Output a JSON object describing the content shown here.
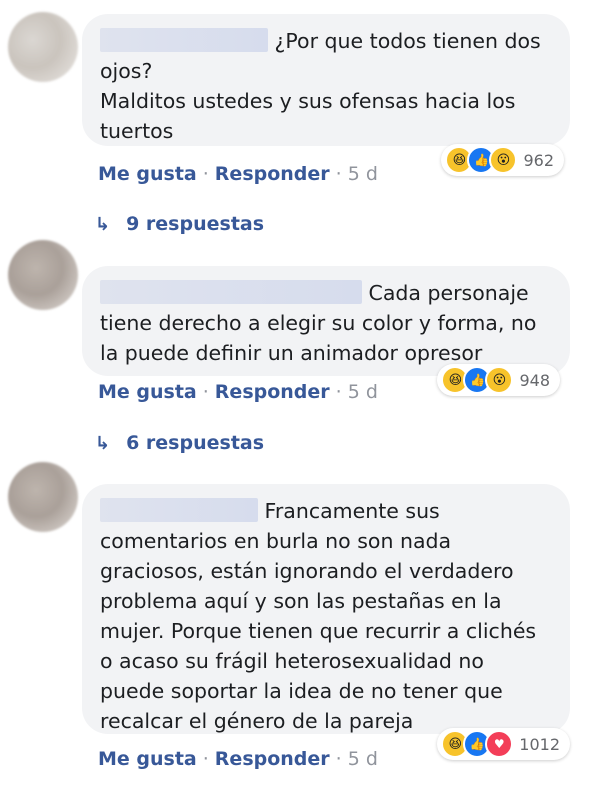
{
  "comments": [
    {
      "text": "¿Por que todos tienen dos ojos?\nMalditos ustedes y sus ofensas hacia los tuertos",
      "text_line1": "¿Por que todos tienen dos",
      "text_rest": "ojos? Malditos ustedes y sus ofensas hacia los tuertos",
      "reactions": [
        "haha",
        "like",
        "wow"
      ],
      "reaction_count": "962",
      "like_label": "Me gusta",
      "reply_label": "Responder",
      "time": "5 d",
      "replies_label": "9 respuestas"
    },
    {
      "text_line1": "Cada personaje",
      "text_rest": "tiene derecho a elegir su color y forma, no la puede definir un animador opresor",
      "reactions": [
        "haha",
        "like",
        "wow"
      ],
      "reaction_count": "948",
      "like_label": "Me gusta",
      "reply_label": "Responder",
      "time": "5 d",
      "replies_label": "6 respuestas"
    },
    {
      "text_line1": "Francamente sus",
      "text_rest": "comentarios en burla no son nada graciosos, están ignorando el verdadero problema aquí y son las pestañas en la mujer. Porque tienen que recurrir a clichés o acaso su frágil heterosexualidad no puede soportar la idea de no tener que recalcar el género de la pareja",
      "reactions": [
        "haha",
        "like",
        "love"
      ],
      "reaction_count": "1012",
      "like_label": "Me gusta",
      "reply_label": "Responder",
      "time": "5 d"
    }
  ],
  "separator": "·",
  "icons": {
    "haha": "😆",
    "like": "👍",
    "wow": "😮",
    "love": "♥",
    "reply_arrow": "↳"
  },
  "colors": {
    "link": "#385898",
    "bubble": "#f2f3f5",
    "like_blue": "#1877f2",
    "emoji_yellow": "#f7c32b",
    "love_red": "#f33e58"
  }
}
